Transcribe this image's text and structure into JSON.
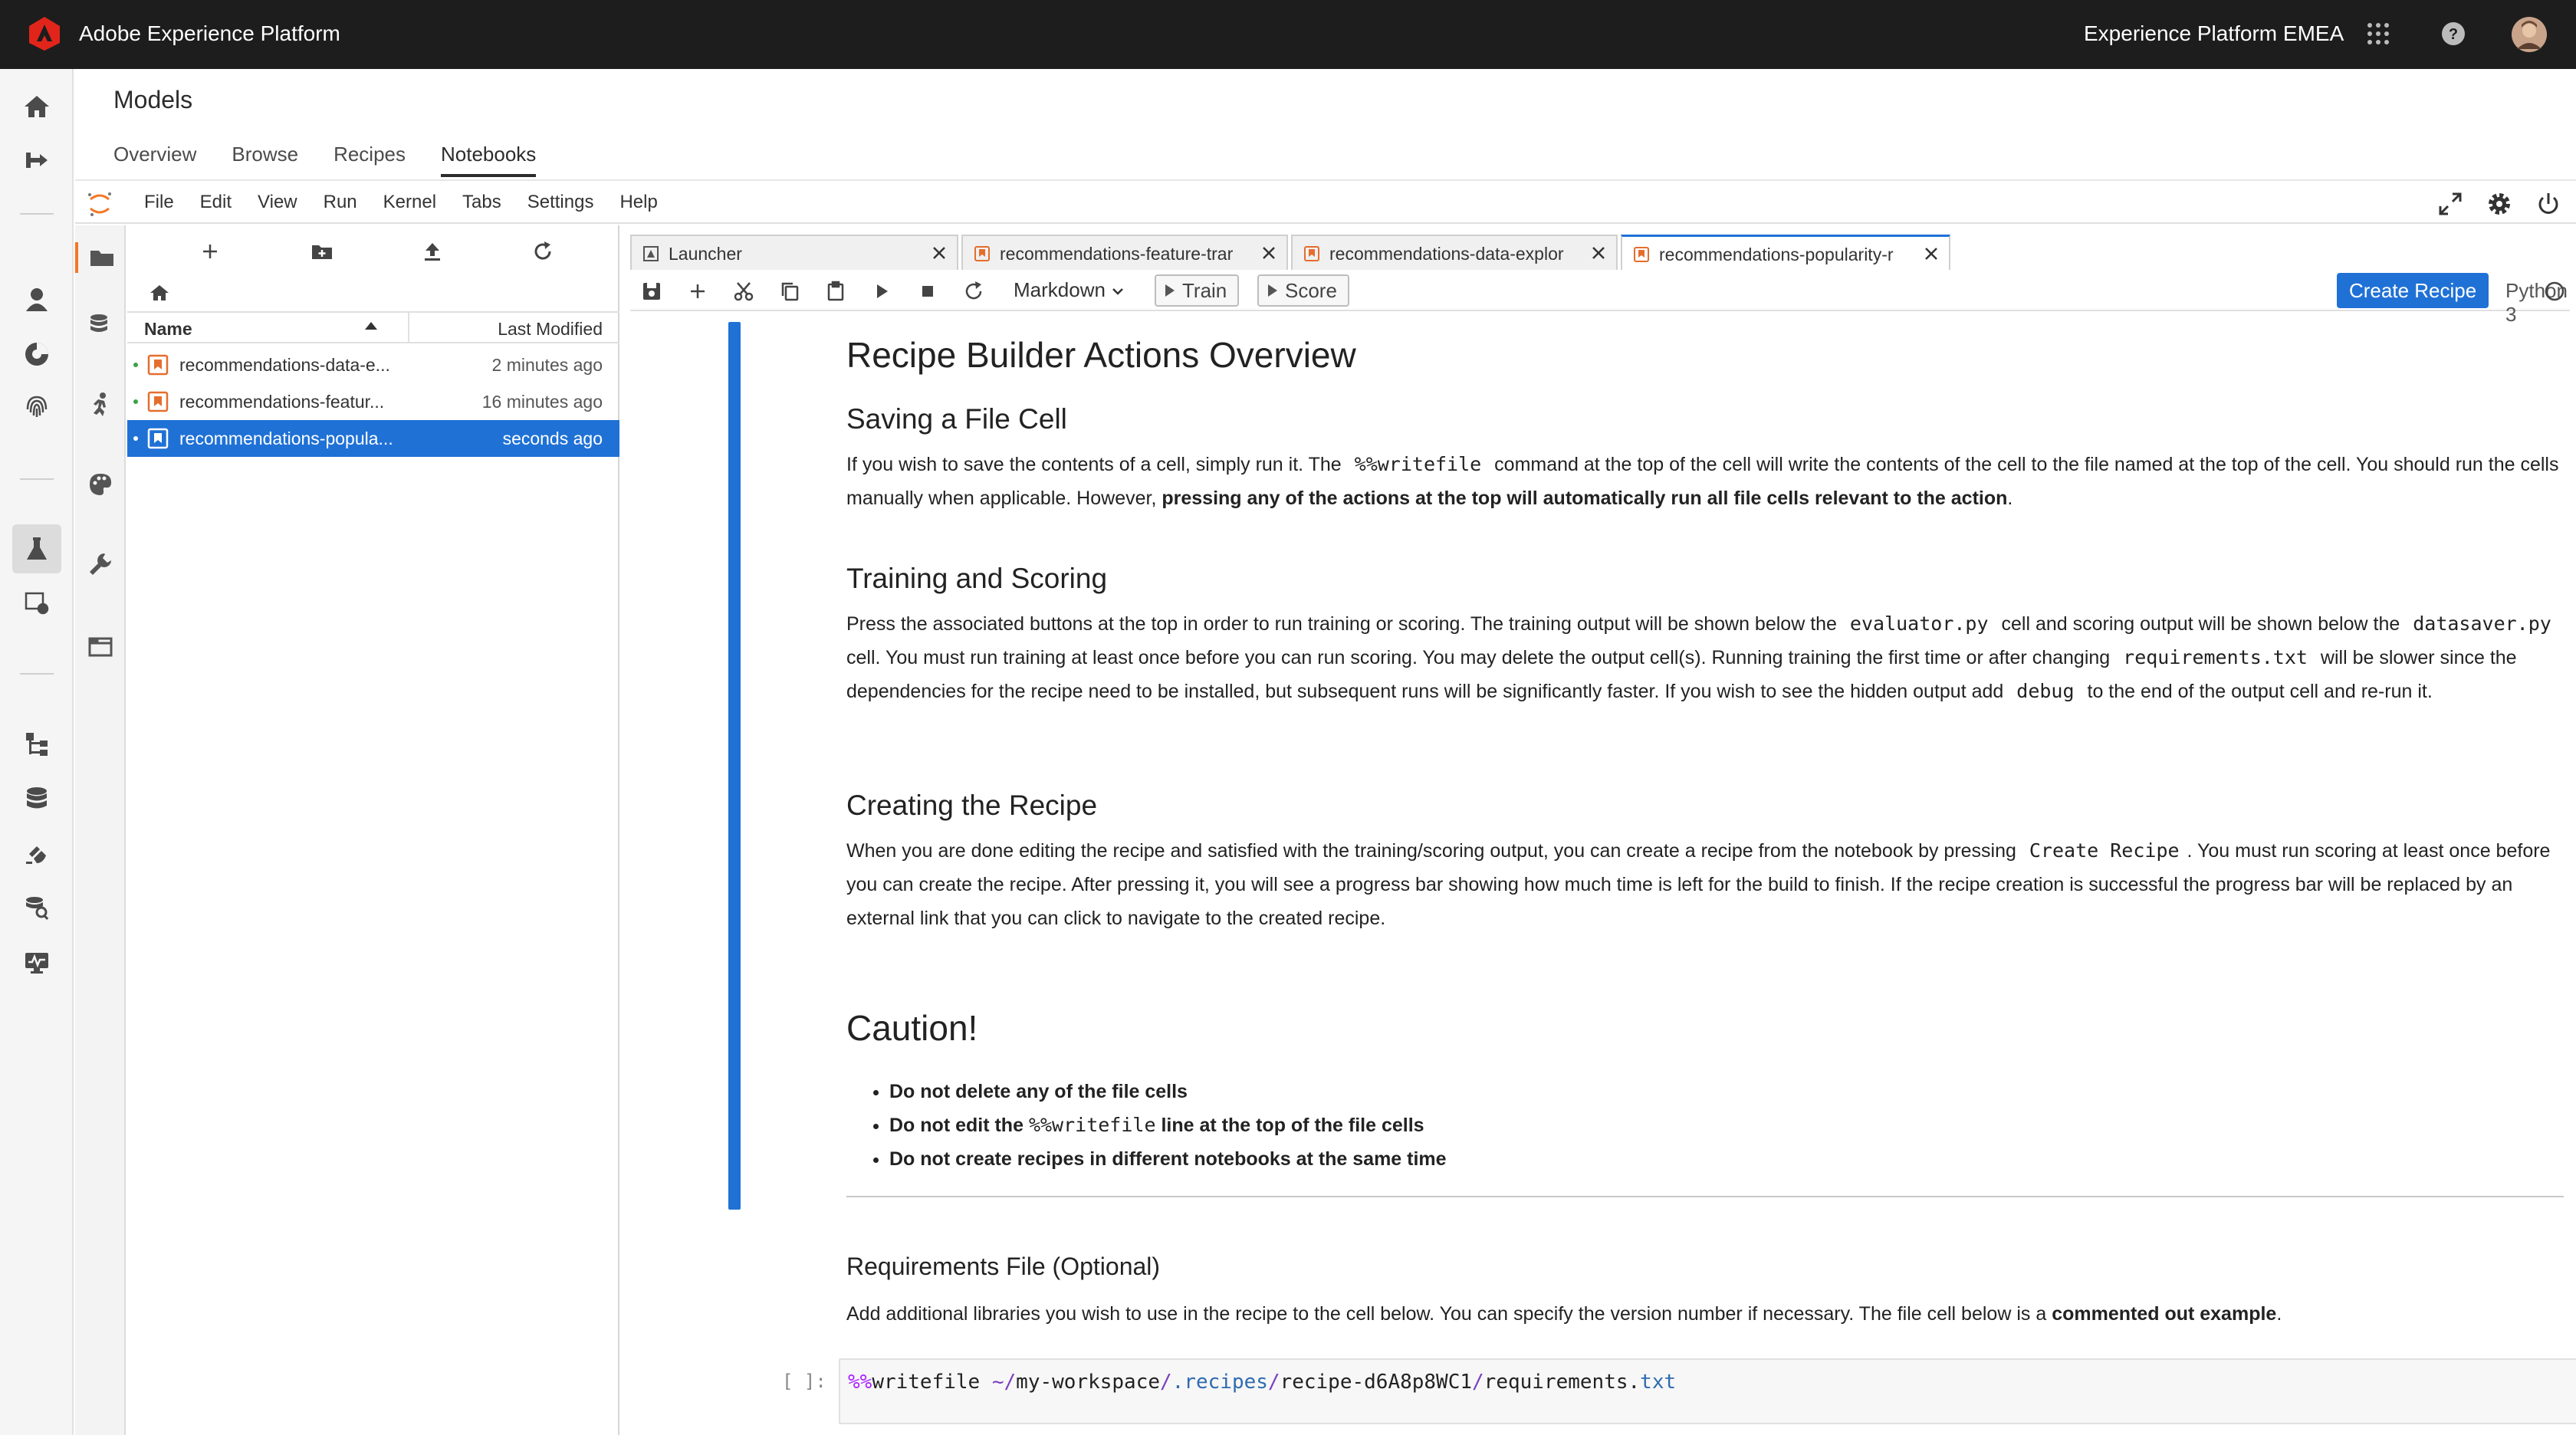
{
  "header": {
    "app_name": "Adobe Experience Platform",
    "org_name": "Experience Platform EMEA",
    "icons": [
      "adobe-logo-icon",
      "apps-grid-icon",
      "help-icon",
      "user-avatar"
    ]
  },
  "rail": {
    "icons": [
      "home-icon",
      "workflows-icon",
      "segments-icon",
      "profiles-icon",
      "identities-icon",
      "models-icon",
      "services-icon",
      "sources-icon",
      "datasets-icon",
      "destinations-icon",
      "queries-icon",
      "monitoring-icon"
    ]
  },
  "page": {
    "title": "Models",
    "tabs": [
      "Overview",
      "Browse",
      "Recipes",
      "Notebooks"
    ],
    "active_tab": "Notebooks"
  },
  "menubar": {
    "items": [
      "File",
      "Edit",
      "View",
      "Run",
      "Kernel",
      "Tabs",
      "Settings",
      "Help"
    ]
  },
  "filebrowser": {
    "col_name": "Name",
    "col_modified": "Last Modified",
    "files": [
      {
        "name": "recommendations-data-e...",
        "modified": "2 minutes ago"
      },
      {
        "name": "recommendations-featur...",
        "modified": "16 minutes ago"
      },
      {
        "name": "recommendations-popula...",
        "modified": "seconds ago"
      }
    ]
  },
  "doc_tabs": [
    {
      "label": "Launcher"
    },
    {
      "label": "recommendations-feature-trar"
    },
    {
      "label": "recommendations-data-explor"
    },
    {
      "label": "recommendations-popularity-r"
    }
  ],
  "toolbar": {
    "cell_type": "Markdown",
    "train_label": "Train",
    "score_label": "Score",
    "create_recipe_label": "Create Recipe",
    "kernel": "Python 3"
  },
  "notebook": {
    "h1": "Recipe Builder Actions Overview",
    "s1_title": "Saving a File Cell",
    "s1_p1a": "If you wish to save the contents of a cell, simply run it. The",
    "s1_code": "%%writefile",
    "s1_p1b": "command at the top of the cell will write the contents of the cell to the file named at the top of the cell. You should run the cells manually when applicable. However,",
    "s1_bold": "pressing any of the actions at the top will automatically run all file cells relevant to the action",
    "s1_end": ".",
    "s2_title": "Training and Scoring",
    "s2_a": "Press the associated buttons at the top in order to run training or scoring. The training output will be shown below the",
    "s2_code1": "evaluator.py",
    "s2_b": "cell and scoring output will be shown below the",
    "s2_code2": "datasaver.py",
    "s2_c": "cell. You must run training at least once before you can run scoring. You may delete the output cell(s). Running training the first time or after changing",
    "s2_code3": "requirements.txt",
    "s2_d": "will be slower since the dependencies for the recipe need to be installed, but subsequent runs will be significantly faster. If you wish to see the hidden output add",
    "s2_code4": "debug",
    "s2_e": "to the end of the output cell and re-run it.",
    "s3_title": "Creating the Recipe",
    "s3_a": "When you are done editing the recipe and satisfied with the training/scoring output, you can create a recipe from the notebook by pressing",
    "s3_code": "Create Recipe",
    "s3_b": ". You must run scoring at least once before you can create the recipe. After pressing it, you will see a progress bar showing how much time is left for the build to finish. If the recipe creation is successful the progress bar will be replaced by an external link that you can click to navigate to the created recipe.",
    "caution_title": "Caution!",
    "caution_1": "Do not delete any of the file cells",
    "caution_2a": "Do not edit the",
    "caution_2_code": "%%writefile",
    "caution_2b": "line at the top of the file cells",
    "caution_3": "Do not create recipes in different notebooks at the same time",
    "req_title_a": "Requirements File",
    "req_title_b": " (Optional)",
    "req_p": "Add additional libraries you wish to use in the recipe to the cell below. You can specify the version number if necessary. The file cell below is a",
    "req_bold": "commented out example",
    "req_end": ".",
    "prompt": "[ ]:",
    "code_magic": "%%",
    "code_cmd": "writefile ",
    "code_tilde": "~/",
    "code_ws": "my-workspace",
    "code_slash1": "/",
    "code_recipes": ".recipes",
    "code_slash2": "/",
    "code_recipe": "recipe-d6A8p8WC1",
    "code_slash3": "/",
    "code_req": "requirements.",
    "code_ext": "txt"
  }
}
